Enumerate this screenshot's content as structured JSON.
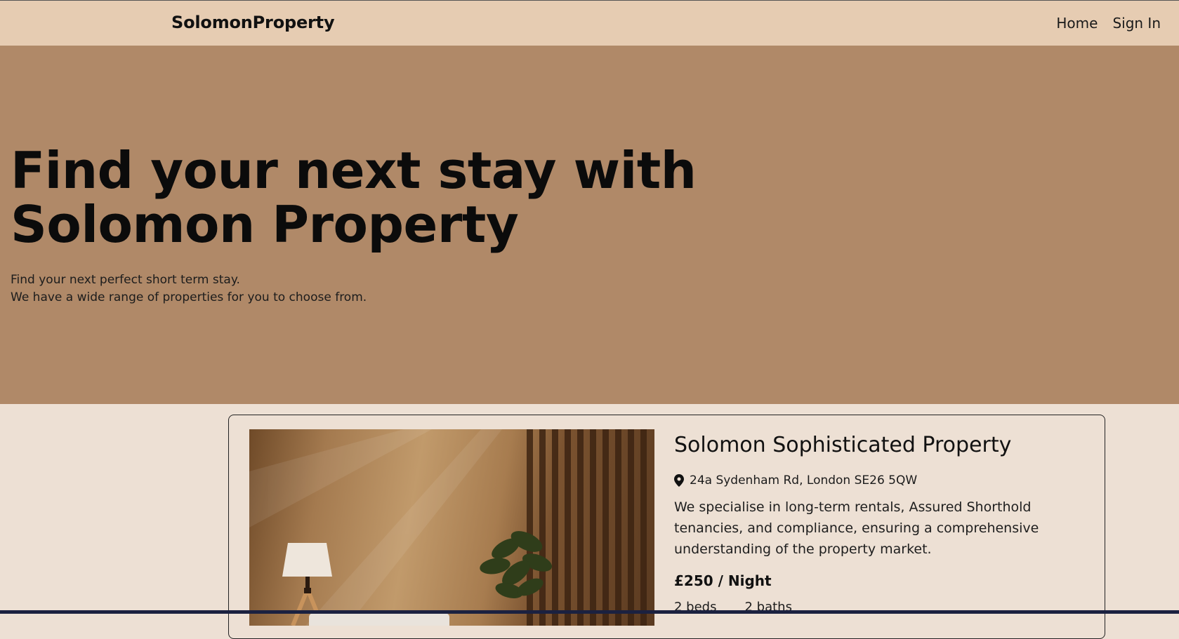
{
  "navbar": {
    "brand": "SolomonProperty",
    "links": [
      {
        "label": "Home"
      },
      {
        "label": "Sign In"
      }
    ]
  },
  "hero": {
    "title": "Find your next stay with Solomon Property",
    "subtitle_lines": [
      "Find your next perfect short term stay.",
      "We have a wide range of properties for you to choose from."
    ]
  },
  "listing": {
    "title": "Solomon Sophisticated Property",
    "address": "24a Sydenham Rd, London SE26 5QW",
    "description": "We specialise in long-term rentals, Assured Shorthold tenancies, and compliance, ensuring a comprehensive understanding of the property market.",
    "price": "£250 / Night",
    "beds": "2 beds",
    "baths": "2 baths",
    "icon": "location-pin-icon"
  },
  "colors": {
    "navbar": "#e6ccb2",
    "hero": "#b08968",
    "page": "#ede0d4"
  }
}
